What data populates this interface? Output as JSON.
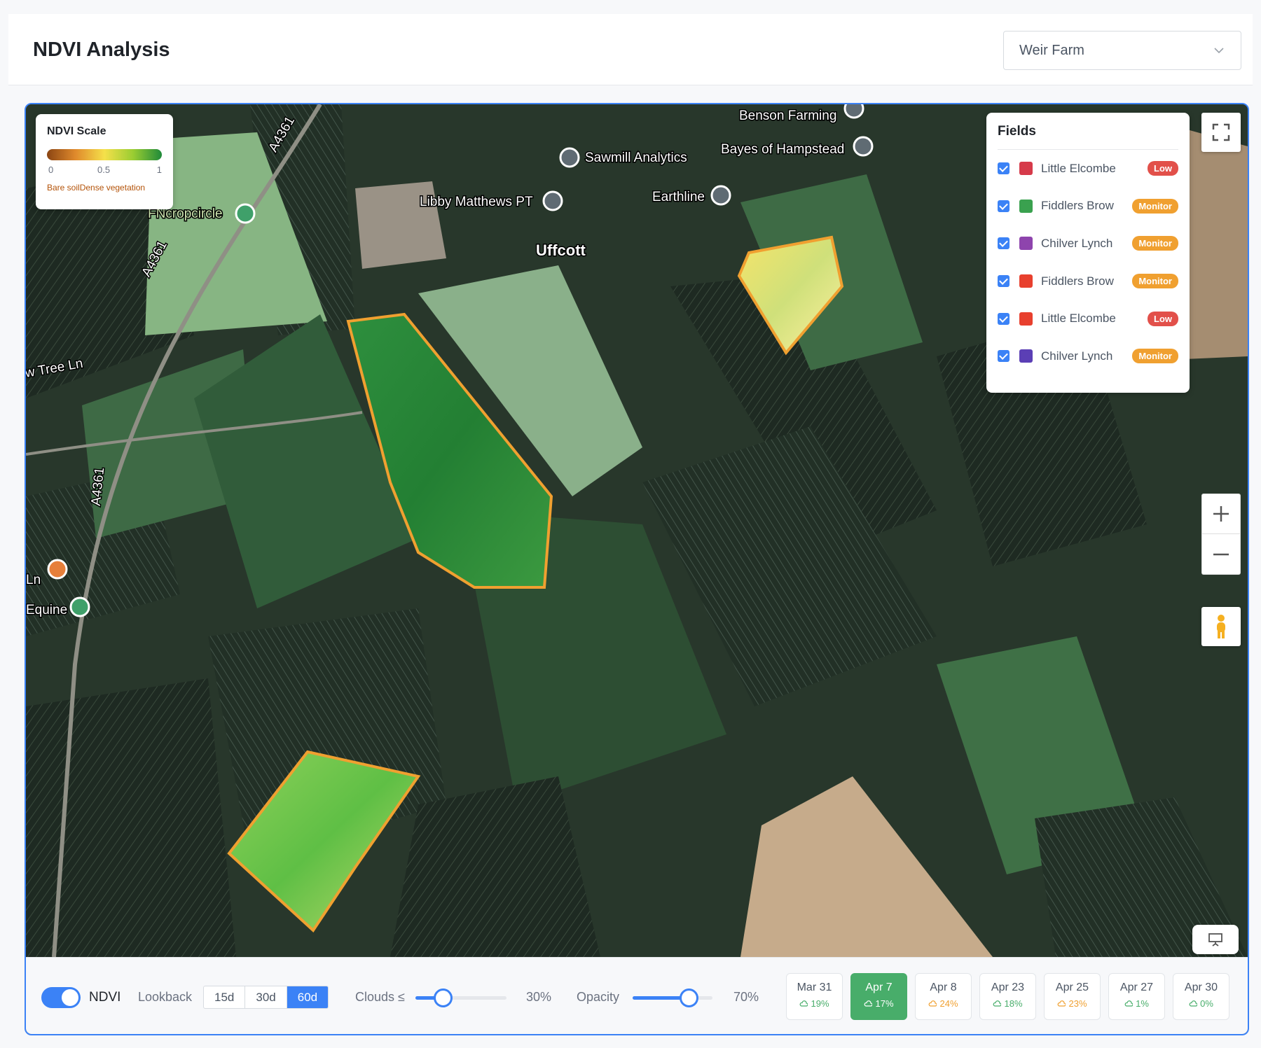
{
  "header": {
    "title": "NDVI Analysis",
    "farm_selected": "Weir Farm"
  },
  "scale": {
    "title": "NDVI Scale",
    "tick_min": "0",
    "tick_mid": "0.5",
    "tick_max": "1",
    "desc_low": "Bare soil",
    "desc_high": "Dense vegetation"
  },
  "fields_panel": {
    "title": "Fields",
    "items": [
      {
        "name": "Little Elcombe",
        "status": "Low",
        "color": "#d63a4a",
        "status_color": "#e2504a",
        "checked": true
      },
      {
        "name": "Fiddlers Brow",
        "status": "Monitor",
        "color": "#3aa14f",
        "status_color": "#f0a030",
        "checked": true
      },
      {
        "name": "Chilver Lynch",
        "status": "Monitor",
        "color": "#8e44ad",
        "status_color": "#f0a030",
        "checked": true
      },
      {
        "name": "Fiddlers Brow",
        "status": "Monitor",
        "color": "#e8402e",
        "status_color": "#f0a030",
        "checked": true
      },
      {
        "name": "Little Elcombe",
        "status": "Low",
        "color": "#e8402e",
        "status_color": "#e2504a",
        "checked": true
      },
      {
        "name": "Chilver Lynch",
        "status": "Monitor",
        "color": "#5b3fb5",
        "status_color": "#f0a030",
        "checked": true
      }
    ]
  },
  "map_labels": {
    "benson": "Benson Farming",
    "sawmill": "Sawmill Analytics",
    "bayes": "Bayes of Hampstead",
    "libby": "Libby Matthews PT",
    "earthline": "Earthline",
    "uffcott": "Uffcott",
    "fncrop": "FNcropcircle",
    "a4361_1": "A4361",
    "a4361_2": "A4361",
    "a4361_3": "A4361",
    "tree_ln": "w Tree Ln",
    "ln": "Ln",
    "equine": "Equine"
  },
  "controls": {
    "ndvi_on": true,
    "ndvi_label": "NDVI",
    "lookback_label": "Lookback",
    "lookback_options": [
      "15d",
      "30d",
      "60d"
    ],
    "lookback_selected": "60d",
    "clouds_label": "Clouds ≤",
    "clouds_value": "30%",
    "clouds_fraction": 0.3,
    "opacity_label": "Opacity",
    "opacity_value": "70%",
    "opacity_fraction": 0.7
  },
  "dates": [
    {
      "date": "Mar 31",
      "cloud": "19%",
      "cloud_color": "#48ad6a"
    },
    {
      "date": "Apr 7",
      "cloud": "17%",
      "cloud_color": "#ffffff",
      "active": true
    },
    {
      "date": "Apr 8",
      "cloud": "24%",
      "cloud_color": "#f0a030"
    },
    {
      "date": "Apr 23",
      "cloud": "18%",
      "cloud_color": "#48ad6a"
    },
    {
      "date": "Apr 25",
      "cloud": "23%",
      "cloud_color": "#f0a030"
    },
    {
      "date": "Apr 27",
      "cloud": "1%",
      "cloud_color": "#48ad6a"
    },
    {
      "date": "Apr 30",
      "cloud": "0%",
      "cloud_color": "#48ad6a"
    }
  ],
  "icons": {
    "farm_chevron": "chevron-down-icon",
    "fullscreen": "fullscreen-icon",
    "zoom_in": "plus-icon",
    "zoom_out": "minus-icon",
    "pegman": "street-view-icon",
    "presentation": "presentation-icon",
    "cloud": "cloud-icon"
  },
  "colors": {
    "accent": "#3b82f6",
    "active_date": "#48ad6a",
    "field_outline": "#f0a030"
  }
}
